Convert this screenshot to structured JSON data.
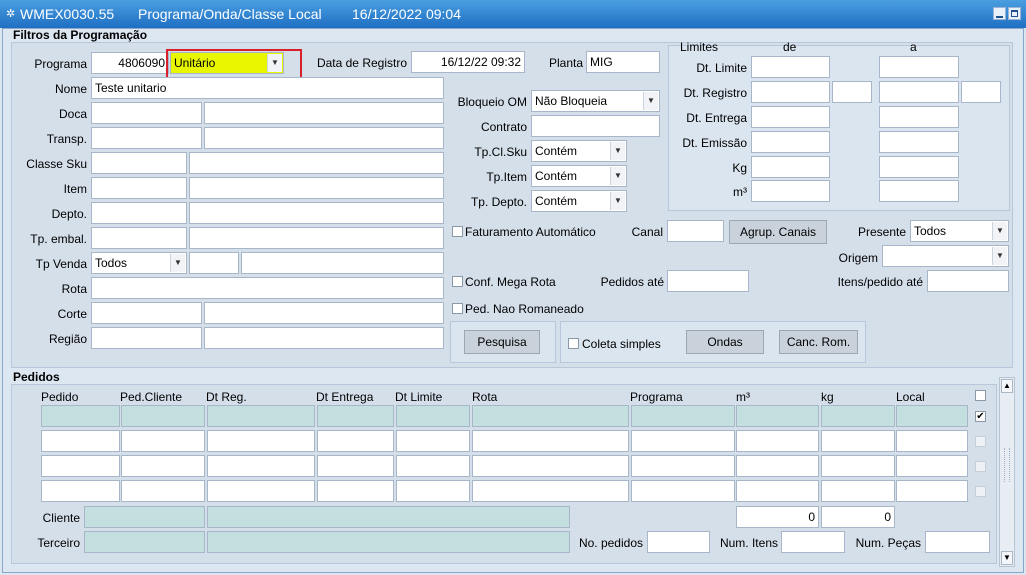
{
  "window": {
    "app_code": "WMEX0030.55",
    "title": "Programa/Onda/Classe Local",
    "datetime": "16/12/2022 09:04"
  },
  "filtros": {
    "title": "Filtros da Programação",
    "programa": {
      "label": "Programa",
      "value": "4806090",
      "type_value": "Unitário"
    },
    "data_registro": {
      "label": "Data de Registro",
      "value": "16/12/22 09:32"
    },
    "planta": {
      "label": "Planta",
      "value": "MIG"
    },
    "nome": {
      "label": "Nome",
      "value": "Teste unitario"
    },
    "doca_label": "Doca",
    "transp_label": "Transp.",
    "classe_sku_label": "Classe Sku",
    "item_label": "Item",
    "depto_label": "Depto.",
    "tp_embal_label": "Tp. embal.",
    "tp_venda": {
      "label": "Tp Venda",
      "value": "Todos"
    },
    "rota_label": "Rota",
    "corte_label": "Corte",
    "regiao_label": "Região",
    "bloqueio_om": {
      "label": "Bloqueio OM",
      "value": "Não Bloqueia"
    },
    "contrato_label": "Contrato",
    "tp_cl_sku": {
      "label": "Tp.Cl.Sku",
      "value": "Contém"
    },
    "tp_item": {
      "label": "Tp.Item",
      "value": "Contém"
    },
    "tp_depto": {
      "label": "Tp. Depto.",
      "value": "Contém"
    },
    "faturamento_automatico": "Faturamento Automático",
    "canal_label": "Canal",
    "agrup_canais_label": "Agrup. Canais",
    "presente": {
      "label": "Presente",
      "value": "Todos"
    },
    "origem_label": "Origem",
    "conf_mega_rota": "Conf. Mega Rota",
    "pedidos_ate_label": "Pedidos até",
    "itens_pedido_ate_label": "Itens/pedido até",
    "ped_nao_romaneado": "Ped. Nao Romaneado",
    "pesquisa_label": "Pesquisa",
    "coleta_simples": "Coleta simples",
    "ondas_label": "Ondas",
    "canc_rom_label": "Canc. Rom."
  },
  "limites": {
    "title": "Limites",
    "de_label": "de",
    "a_label": "a",
    "rows": [
      "Dt. Limite",
      "Dt. Registro",
      "Dt. Entrega",
      "Dt. Emissão",
      "Kg",
      "m³"
    ]
  },
  "pedidos": {
    "title": "Pedidos",
    "columns": [
      "Pedido",
      "Ped.Cliente",
      "Dt Reg.",
      "Dt Entrega",
      "Dt Limite",
      "Rota",
      "Programa",
      "m³",
      "kg",
      "Local"
    ],
    "cliente_label": "Cliente",
    "terceiro_label": "Terceiro",
    "total_m3": "0",
    "total_kg": "0",
    "no_pedidos_label": "No. pedidos",
    "num_itens_label": "Num. Itens",
    "num_pecas_label": "Num. Peças"
  }
}
